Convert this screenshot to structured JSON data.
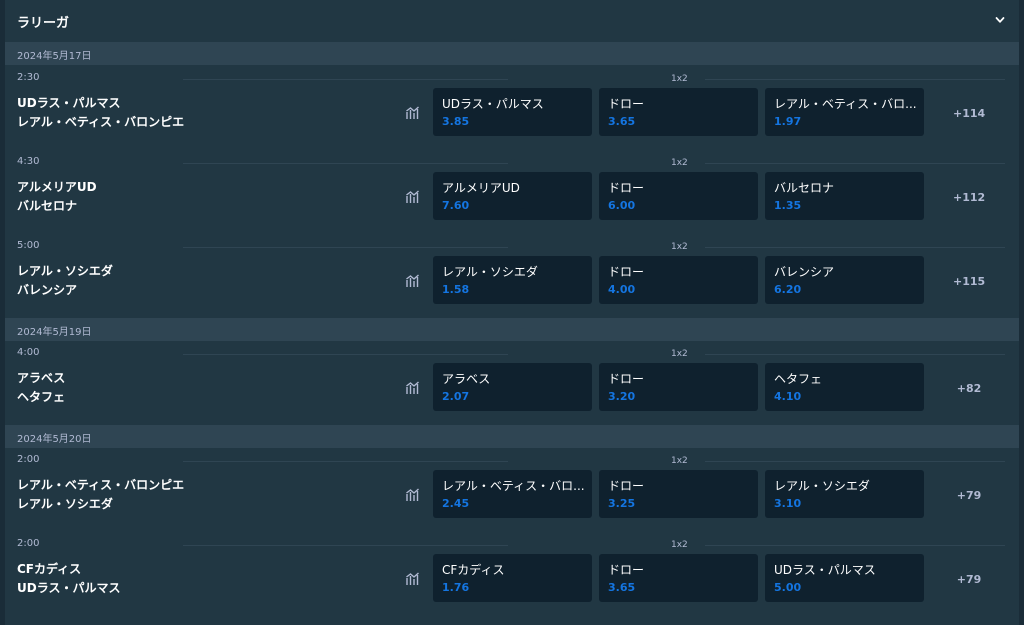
{
  "league": {
    "title": "ラリーガ",
    "chevron_icon": "chevron-down-icon"
  },
  "dates": [
    {
      "label": "2024年5月17日"
    },
    {
      "label": "2024年5月19日"
    },
    {
      "label": "2024年5月20日"
    }
  ],
  "matches": [
    {
      "time": "2:30",
      "market": "1x2",
      "team1": "UDラス・パルマス",
      "team2": "レアル・ベティス・バロンピエ",
      "odds": [
        {
          "name": "UDラス・パルマス",
          "price": "3.85"
        },
        {
          "name": "ドロー",
          "price": "3.65"
        },
        {
          "name": "レアル・ベティス・バロ...",
          "price": "1.97"
        }
      ],
      "more": "+114"
    },
    {
      "time": "4:30",
      "market": "1x2",
      "team1": "アルメリアUD",
      "team2": "バルセロナ",
      "odds": [
        {
          "name": "アルメリアUD",
          "price": "7.60"
        },
        {
          "name": "ドロー",
          "price": "6.00"
        },
        {
          "name": "バルセロナ",
          "price": "1.35"
        }
      ],
      "more": "+112"
    },
    {
      "time": "5:00",
      "market": "1x2",
      "team1": "レアル・ソシエダ",
      "team2": "バレンシア",
      "odds": [
        {
          "name": "レアル・ソシエダ",
          "price": "1.58"
        },
        {
          "name": "ドロー",
          "price": "4.00"
        },
        {
          "name": "バレンシア",
          "price": "6.20"
        }
      ],
      "more": "+115"
    },
    {
      "time": "4:00",
      "market": "1x2",
      "team1": "アラベス",
      "team2": "ヘタフェ",
      "odds": [
        {
          "name": "アラベス",
          "price": "2.07"
        },
        {
          "name": "ドロー",
          "price": "3.20"
        },
        {
          "name": "ヘタフェ",
          "price": "4.10"
        }
      ],
      "more": "+82"
    },
    {
      "time": "2:00",
      "market": "1x2",
      "team1": "レアル・ベティス・バロンピエ",
      "team2": "レアル・ソシエダ",
      "odds": [
        {
          "name": "レアル・ベティス・バロ...",
          "price": "2.45"
        },
        {
          "name": "ドロー",
          "price": "3.25"
        },
        {
          "name": "レアル・ソシエダ",
          "price": "3.10"
        }
      ],
      "more": "+79"
    },
    {
      "time": "2:00",
      "market": "1x2",
      "team1": "CFカディス",
      "team2": "UDラス・パルマス",
      "odds": [
        {
          "name": "CFカディス",
          "price": "1.76"
        },
        {
          "name": "ドロー",
          "price": "3.65"
        },
        {
          "name": "UDラス・パルマス",
          "price": "5.00"
        }
      ],
      "more": "+79"
    }
  ],
  "icons": {
    "stats": "stats-chart-icon"
  },
  "colors": {
    "background": "#213743",
    "date_bar": "#2f4553",
    "odd_button": "#0f212e",
    "price": "#1475e1",
    "muted": "#b1bad3"
  }
}
